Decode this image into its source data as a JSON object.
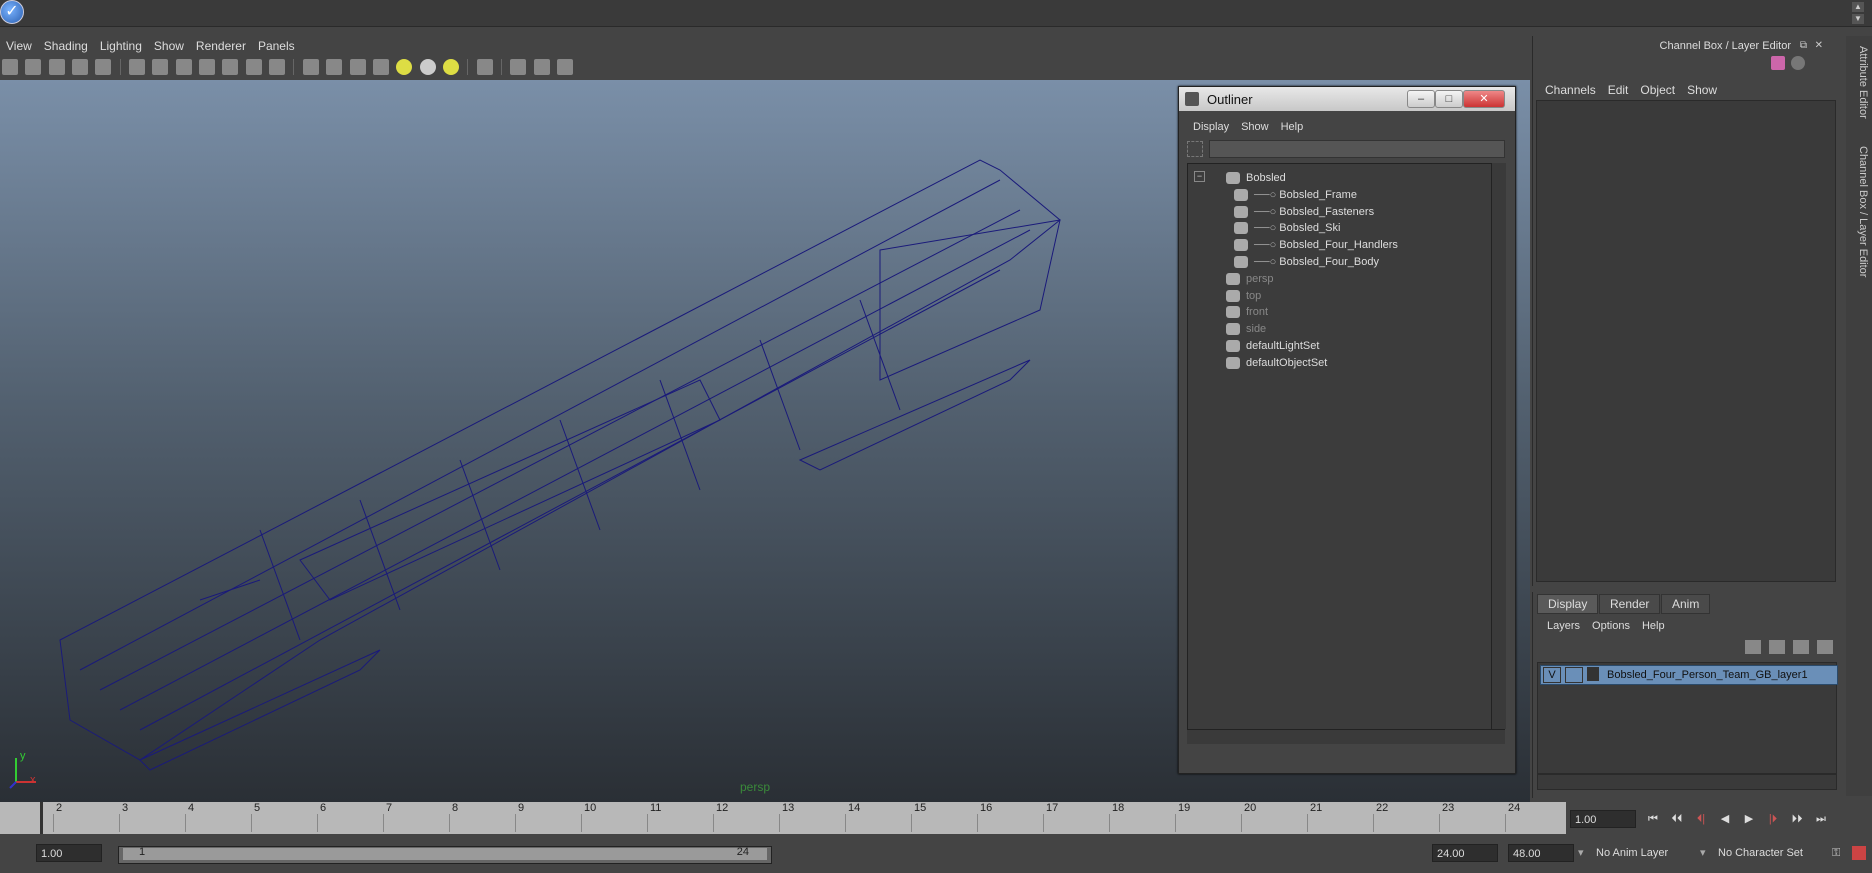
{
  "menubar": [
    "View",
    "Shading",
    "Lighting",
    "Show",
    "Renderer",
    "Panels"
  ],
  "viewport": {
    "camera_label": "persp"
  },
  "axis": {
    "y": "y",
    "x": "x"
  },
  "outliner": {
    "title": "Outliner",
    "menu": [
      "Display",
      "Show",
      "Help"
    ],
    "items": [
      {
        "label": "Bobsled",
        "indent": 0,
        "dim": false
      },
      {
        "label": "Bobsled_Frame",
        "indent": 1,
        "dim": false
      },
      {
        "label": "Bobsled_Fasteners",
        "indent": 1,
        "dim": false
      },
      {
        "label": "Bobsled_Ski",
        "indent": 1,
        "dim": false
      },
      {
        "label": "Bobsled_Four_Handlers",
        "indent": 1,
        "dim": false
      },
      {
        "label": "Bobsled_Four_Body",
        "indent": 1,
        "dim": false
      },
      {
        "label": "persp",
        "indent": 0,
        "dim": true
      },
      {
        "label": "top",
        "indent": 0,
        "dim": true
      },
      {
        "label": "front",
        "indent": 0,
        "dim": true
      },
      {
        "label": "side",
        "indent": 0,
        "dim": true
      },
      {
        "label": "defaultLightSet",
        "indent": 0,
        "dim": false
      },
      {
        "label": "defaultObjectSet",
        "indent": 0,
        "dim": false
      }
    ]
  },
  "channelbox": {
    "title": "Channel Box / Layer Editor",
    "menu": [
      "Channels",
      "Edit",
      "Object",
      "Show"
    ]
  },
  "side_tabs": [
    "Attribute Editor",
    "Channel Box / Layer Editor"
  ],
  "layers": {
    "tabs": [
      "Display",
      "Render",
      "Anim"
    ],
    "menu": [
      "Layers",
      "Options",
      "Help"
    ],
    "layer": {
      "visible": "V",
      "name": "Bobsled_Four_Person_Team_GB_layer1"
    }
  },
  "timeline": {
    "ticks": [
      "2",
      "3",
      "4",
      "5",
      "6",
      "7",
      "8",
      "9",
      "10",
      "11",
      "12",
      "13",
      "14",
      "15",
      "16",
      "17",
      "18",
      "19",
      "20",
      "21",
      "22",
      "23",
      "24"
    ],
    "current_time": "1.00"
  },
  "range": {
    "start": "1.00",
    "slider_start": "1",
    "slider_end": "24",
    "end": "24.00",
    "max": "48.00",
    "anim_layer": "No Anim Layer",
    "char_set": "No Character Set"
  }
}
